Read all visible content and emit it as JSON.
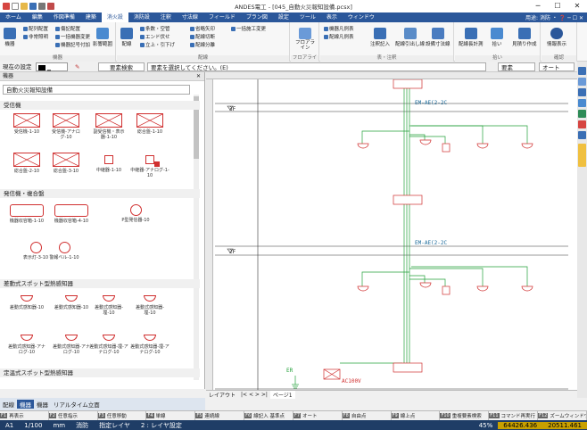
{
  "window": {
    "title": "ANDES電工 - [045_自動火災報知設備.pcsx]"
  },
  "menu": {
    "items": [
      "ホーム",
      "編集",
      "作図準備",
      "建築",
      "消火設",
      "消防設",
      "注釈",
      "寸法線",
      "フィールド",
      "プラン図",
      "設定",
      "ツール",
      "表示",
      "ウィンドウ"
    ],
    "active_index": 4,
    "right": "用途: 消防 ・ ❓ ─ ☐ ✕"
  },
  "ribbon": {
    "groups": [
      "機器",
      "配線",
      "フロアライン",
      "表・注釈",
      "拾い",
      "確認"
    ],
    "g1": {
      "big": [
        "機器",
        "影響範囲"
      ],
      "small": [
        "配列配置",
        "非常照明",
        "傷記配置",
        "一括機器変更",
        "機器記号付加"
      ]
    },
    "g2": {
      "big": [
        "配線"
      ],
      "small": [
        "条数・空管",
        "エンド伏せ",
        "立上・引下げ",
        "省略矢印",
        "配線切断",
        "配線分離",
        "一括施工変更"
      ]
    },
    "g3": {
      "big": [
        "フロアライン"
      ]
    },
    "g4": {
      "small": [
        "機器凡例表",
        "配線凡例表"
      ],
      "big": [
        "注釈記入",
        "配線引出し線",
        "設備寸法線"
      ]
    },
    "g5": {
      "big": [
        "配線長計測",
        "拾い",
        "見積り作成"
      ]
    },
    "g6": {
      "big": [
        "情報表示"
      ]
    }
  },
  "cmd": {
    "layer_label": "現在の設定",
    "search_btn": "要素検索",
    "prompt": "要素を選択してください。(E)",
    "right1": "要素",
    "right2": "オート"
  },
  "panel": {
    "title": "機器",
    "selector": "自動火災報知設備",
    "categories": [
      "受信機",
      "発信機・複合盤",
      "差動式スポット型熱感知器",
      "定温式スポット型熱感知器"
    ],
    "items": [
      {
        "label": "受信機-1-10"
      },
      {
        "label": "受信機-アナログ-10"
      },
      {
        "label": "副受信機・表示器-1-10"
      },
      {
        "label": "総合盤-1-10"
      },
      {
        "label": "総合盤-2-10"
      },
      {
        "label": "総合盤-3-10"
      },
      {
        "label": "中継器-1-10"
      },
      {
        "label": "中継器-アナログ-1-10"
      },
      {
        "label": "機器収容箱-1-10"
      },
      {
        "label": "機器収容箱-4-10"
      },
      {
        "label": "P型発信器-10"
      },
      {
        "label": "表示灯-3-10"
      },
      {
        "label": "警報ベル-1-10"
      },
      {
        "label": "差動式感知器-10"
      },
      {
        "label": "差動式感知器-10"
      },
      {
        "label": "差動式感知器-埋-10"
      },
      {
        "label": "差動式感知器-埋-10"
      },
      {
        "label": "差動式感知器-アナログ-10"
      },
      {
        "label": "差動式感知器-アナログ-10"
      },
      {
        "label": "差動式感知器-埋-アナログ-10"
      },
      {
        "label": "差動式感知器-埋-アナログ-10"
      }
    ],
    "tabs": [
      "機器",
      "機器集",
      "リアルタイム"
    ]
  },
  "bottom_tabs": [
    "配線",
    "機器",
    "機器",
    "リアルタイム立面"
  ],
  "canvas": {
    "floors": [
      "3F",
      "2F",
      "1F"
    ],
    "cable_labels": [
      "EM-AE(2-2C",
      "EM-AE(2-2C"
    ],
    "ref_labels": [
      "ER",
      "AC100V"
    ],
    "sheet_tab": "レイアウト",
    "page": "ページ1"
  },
  "fkeys": [
    {
      "k": "F1",
      "t": "再表示"
    },
    {
      "k": "F2",
      "t": "任意指示"
    },
    {
      "k": "F3",
      "t": "任意移動"
    },
    {
      "k": "F4",
      "t": "単線"
    },
    {
      "k": "F5",
      "t": "連続線"
    },
    {
      "k": "F6",
      "t": "線記入 基準点"
    },
    {
      "k": "F7",
      "t": "オート"
    },
    {
      "k": "F8",
      "t": "自由点"
    },
    {
      "k": "F9",
      "t": "線上点"
    },
    {
      "k": "F10",
      "t": "重複要素検索"
    },
    {
      "k": "F11",
      "t": "コマンド再実行"
    },
    {
      "k": "F12",
      "t": "ズームウィンドウ"
    }
  ],
  "status": {
    "paper": "A1",
    "scale": "1/100",
    "unit": "mm",
    "layer_label": "消防",
    "layer_mode": "指定レイヤ",
    "layer_set": "2 : レイヤ設定",
    "coord_x": "64426.436",
    "coord_y": "20511.461",
    "zoom": "45%"
  },
  "colors": {
    "accent": "#2b579a",
    "symbol_red": "#d03030",
    "wire_green": "#22a03a",
    "status_bg": "#1f3d66"
  }
}
